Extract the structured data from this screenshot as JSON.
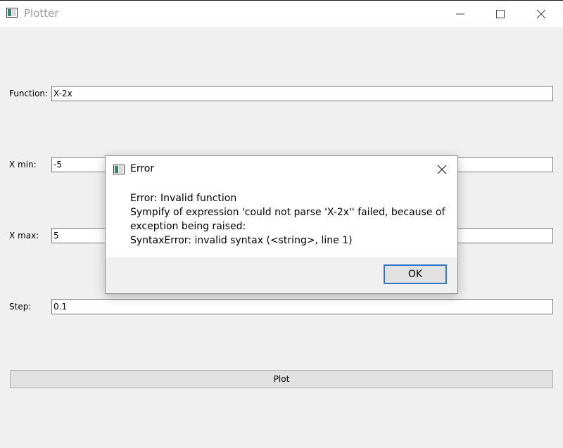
{
  "window": {
    "title": "Plotter",
    "icon": "app-window-icon",
    "controls": [
      "minimize-icon",
      "maximize-icon",
      "close-icon"
    ]
  },
  "form": {
    "function_label": "Function:",
    "function_value": "X-2x",
    "xmin_label": "X min:",
    "xmin_value": "-5",
    "xmax_label": "X max:",
    "xmax_value": "5",
    "step_label": "Step:",
    "step_value": "0.1",
    "plot_button": "Plot"
  },
  "dialog": {
    "title": "Error",
    "message_lines": [
      "Error: Invalid function",
      "Sympify of expression 'could not parse 'X-2x'' failed, because of",
      "exception being raised:",
      "SyntaxError: invalid syntax (<string>, line 1)"
    ],
    "ok_button": "OK"
  },
  "colors": {
    "background": "#f0f0f0",
    "focus_border": "#2f76c7",
    "title_text": "#9a9a9a"
  }
}
